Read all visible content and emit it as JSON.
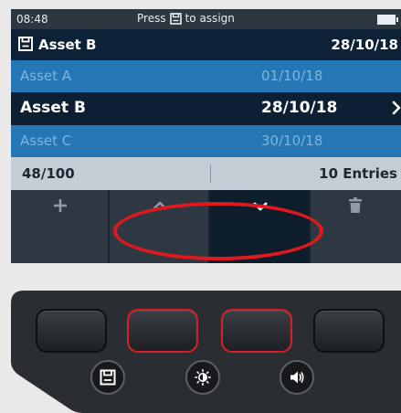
{
  "statusbar": {
    "time": "08:48",
    "hint_prefix": "Press",
    "hint_suffix": "to assign",
    "hint_icon": "save-icon",
    "battery_icon": "battery-icon"
  },
  "header": {
    "icon": "save-icon",
    "asset_name": "Asset B",
    "date": "28/10/18"
  },
  "list": {
    "rows": [
      {
        "name": "Asset A",
        "date": "01/10/18",
        "selected": false
      },
      {
        "name": "Asset B",
        "date": "28/10/18",
        "selected": true,
        "icon": "chevron-right-icon"
      },
      {
        "name": "Asset C",
        "date": "30/10/18",
        "selected": false
      }
    ]
  },
  "info": {
    "count": "48/100",
    "entries": "10 Entries"
  },
  "softkeys": [
    {
      "icon": "plus-icon"
    },
    {
      "icon": "chevron-up-icon"
    },
    {
      "icon": "chevron-down-icon",
      "active": true
    },
    {
      "icon": "trash-icon"
    }
  ],
  "keypad": {
    "function_keys": [
      {
        "highlighted": false
      },
      {
        "highlighted": true
      },
      {
        "highlighted": true
      },
      {
        "highlighted": false
      }
    ],
    "round_buttons": [
      {
        "icon": "save-icon"
      },
      {
        "icon": "brightness-icon"
      },
      {
        "icon": "volume-icon"
      }
    ]
  },
  "colors": {
    "accent_highlight": "#e0191f",
    "list_blue": "#2476b4",
    "list_selected": "#0d2033"
  }
}
